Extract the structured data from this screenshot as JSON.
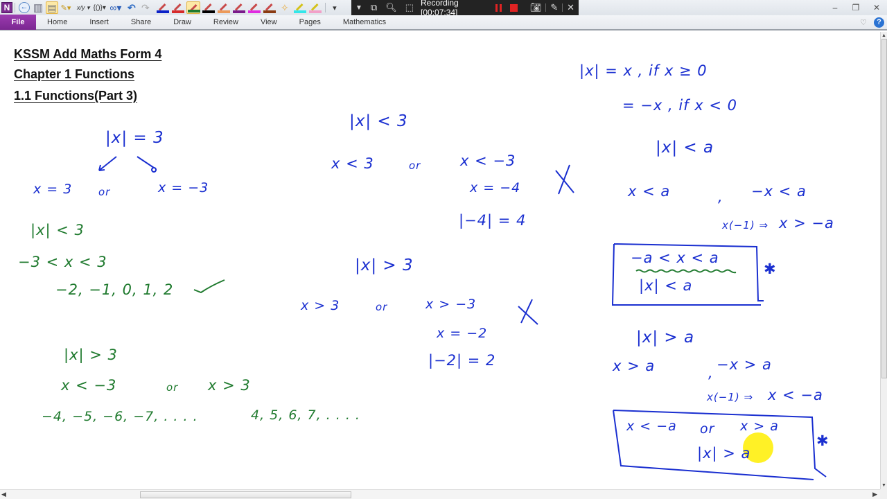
{
  "app": {
    "logo_letter": "N",
    "window_controls": [
      "minimize",
      "restore",
      "close"
    ]
  },
  "quick_access_toolbar": {
    "items": [
      {
        "name": "back-icon",
        "glyph": "←"
      },
      {
        "name": "dock-to-desktop-icon",
        "glyph": "▥"
      },
      {
        "name": "full-page-view-icon",
        "glyph": "▤"
      },
      {
        "name": "pen-tools-icon",
        "glyph": "✎▾"
      },
      {
        "name": "fraction-icon",
        "glyph": "x/y ▾"
      },
      {
        "name": "equation-icon",
        "glyph": "{()}▾"
      },
      {
        "name": "infinity-icon",
        "glyph": "∞▾"
      },
      {
        "name": "undo-icon",
        "glyph": "↶"
      },
      {
        "name": "redo-icon",
        "glyph": "↷"
      }
    ],
    "pens": [
      {
        "name": "pen-blue",
        "color": "#0b22c8"
      },
      {
        "name": "pen-red",
        "color": "#d62b2b"
      },
      {
        "name": "pen-green",
        "color": "#1f7a2e",
        "selected": true
      },
      {
        "name": "pen-black",
        "color": "#000000"
      },
      {
        "name": "pen-orange",
        "color": "#ec9a5a"
      },
      {
        "name": "pen-purple",
        "color": "#7a1b8a"
      },
      {
        "name": "pen-magenta",
        "color": "#e02be0"
      },
      {
        "name": "pen-brown",
        "color": "#8a3b12"
      },
      {
        "name": "eraser",
        "color": "#f2c9b0"
      },
      {
        "name": "highlighter-cyan",
        "color": "#33e6ea"
      },
      {
        "name": "highlighter-pink",
        "color": "#f2a0c8"
      }
    ],
    "customize_glyph": "▾"
  },
  "recording_bar": {
    "label": "Recording [00:07:34]",
    "timer": "00:07:34",
    "menu_glyph": "▼",
    "buttons": [
      "menu",
      "window",
      "zoom",
      "region",
      "pause",
      "stop",
      "screenshot",
      "draw",
      "close"
    ]
  },
  "ribbon": {
    "file_tab": "File",
    "tabs": [
      "Home",
      "Insert",
      "Share",
      "Draw",
      "Review",
      "View",
      "Pages",
      "Mathematics"
    ]
  },
  "page": {
    "titles": [
      "KSSM Add Maths  Form 4",
      "Chapter 1 Functions",
      "1.1 Functions(Part 3)"
    ],
    "ink": {
      "left_column": {
        "abs_eq": "|x| = 3",
        "abs_eq_solutions": [
          "x = 3",
          "or",
          "x = −3"
        ],
        "abs_lt": "|x| < 3",
        "abs_lt_range": "−3 < x < 3",
        "abs_lt_values": "−2, −1, 0, 1, 2",
        "abs_gt": "|x| > 3",
        "abs_gt_range": [
          "x < −3",
          "or",
          "x > 3"
        ],
        "abs_gt_values_neg": "−4, −5, −6, −7, . . . .",
        "abs_gt_values_pos": "4, 5, 6, 7, . . . ."
      },
      "middle_column": {
        "abs_lt": "|x| < 3",
        "wrong_lt": [
          "x < 3",
          "or",
          "x < −3"
        ],
        "wrong_lt_check": "x = −4",
        "wrong_lt_abs": "|−4| = 4",
        "abs_gt": "|x| > 3",
        "wrong_gt": [
          "x > 3",
          "or",
          "x > −3"
        ],
        "wrong_gt_check": "x = −2",
        "wrong_gt_abs": "|−2| = 2",
        "wrong_mark": "X"
      },
      "right_column": {
        "def_pos": "|x| = x , if x ≥ 0",
        "def_neg": "= −x , if x < 0",
        "abs_lt_a": "|x| < a",
        "lt_cases": [
          "x < a",
          ",",
          "−x < a"
        ],
        "lt_multiply": "x(−1) ⇒",
        "lt_result": "x > −a",
        "lt_box_line1": "−a < x < a",
        "lt_box_line2": "|x| < a",
        "abs_gt_a": "|x| > a",
        "gt_cases": [
          "x > a",
          ",",
          "−x > a"
        ],
        "gt_multiply": "x(−1) ⇒",
        "gt_result": "x < −a",
        "gt_box_line1": [
          "x < −a",
          "or",
          "x > a"
        ],
        "gt_box_line2": "|x| > a",
        "star": "✱"
      }
    },
    "ink_colors": {
      "blue": "#1a2fd0",
      "green": "#1f7a2e",
      "highlight": "#ffee00"
    }
  }
}
